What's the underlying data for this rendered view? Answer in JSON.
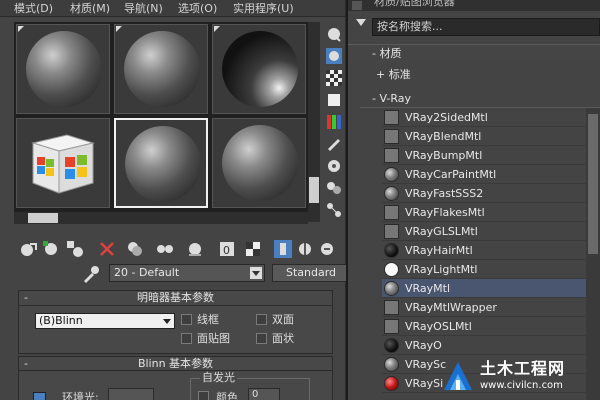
{
  "menubar": {
    "items": [
      "模式(D)",
      "材质(M)",
      "导航(N)",
      "选项(O)",
      "实用程序(U)"
    ]
  },
  "material_editor": {
    "material_name": "20 - Default",
    "material_type_button": "Standard",
    "shader_rollout": {
      "title": "明暗器基本参数",
      "collapse": "-",
      "shader": "(B)Blinn",
      "checkboxes": [
        "线框",
        "双面",
        "面贴图",
        "面状"
      ]
    },
    "blinn_rollout": {
      "title": "Blinn 基本参数",
      "collapse": "-",
      "ambient_label": "环境光:",
      "self_illum_title": "自发光",
      "color_label": "颜色",
      "self_illum_value": "0"
    },
    "slots": [
      {
        "kind": "sphere"
      },
      {
        "kind": "sphere"
      },
      {
        "kind": "sphere-dark"
      },
      {
        "kind": "cube"
      },
      {
        "kind": "sphere"
      },
      {
        "kind": "sphere"
      }
    ]
  },
  "browser": {
    "title": "材质/贴图浏览器",
    "search_placeholder": "按名称搜索...",
    "group_material": "- 材质",
    "group_standard": "+ 标准",
    "group_vray": "- V-Ray",
    "materials": [
      {
        "label": "VRay2SidedMtl",
        "swatch": "grey"
      },
      {
        "label": "VRayBlendMtl",
        "swatch": "grey"
      },
      {
        "label": "VRayBumpMtl",
        "swatch": "grey"
      },
      {
        "label": "VRayCarPaintMtl",
        "swatch": "sphere"
      },
      {
        "label": "VRayFastSSS2",
        "swatch": "sphere"
      },
      {
        "label": "VRayFlakesMtl",
        "swatch": "grey"
      },
      {
        "label": "VRayGLSLMtl",
        "swatch": "grey"
      },
      {
        "label": "VRayHairMtl",
        "swatch": "black"
      },
      {
        "label": "VRayLightMtl",
        "swatch": "white"
      },
      {
        "label": "VRayMtl",
        "swatch": "sphere"
      },
      {
        "label": "VRayMtlWrapper",
        "swatch": "grey"
      },
      {
        "label": "VRayOSLMtl",
        "swatch": "grey"
      },
      {
        "label": "VRayO",
        "swatch": "black"
      },
      {
        "label": "VRaySc",
        "swatch": "sphere"
      },
      {
        "label": "VRaySi",
        "swatch": "red"
      }
    ]
  },
  "watermark": {
    "title": "土木工程网",
    "url": "www.civilcn.com"
  },
  "colors": {
    "panel": "#444444",
    "selection": "#4a5570",
    "accent_blue": "#4a7fc0"
  }
}
